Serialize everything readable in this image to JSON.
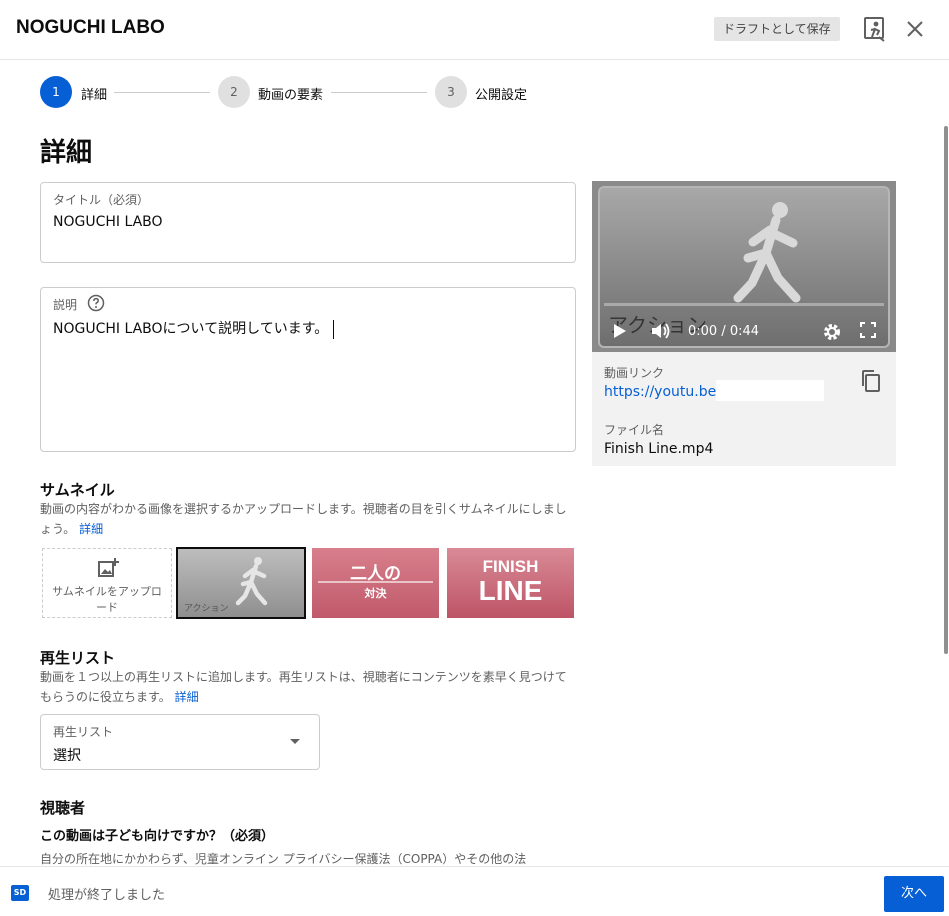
{
  "header": {
    "title": "NOGUCHI LABO",
    "save_draft_label": "ドラフトとして保存",
    "feedback_icon": "feedback-icon",
    "close_icon": "close-icon"
  },
  "stepper": {
    "steps": [
      {
        "number": "1",
        "label": "詳細",
        "active": true
      },
      {
        "number": "2",
        "label": "動画の要素",
        "active": false
      },
      {
        "number": "3",
        "label": "公開設定",
        "active": false
      }
    ]
  },
  "page": {
    "title": "詳細"
  },
  "title_field": {
    "label": "タイトル（必須）",
    "value": "NOGUCHI LABO"
  },
  "description_field": {
    "label": "説明",
    "value": "NOGUCHI LABOについて説明しています。",
    "help_icon": "help-icon"
  },
  "video_card": {
    "overlay_text": "アクション",
    "time": "0:00 / 0:44",
    "link_label": "動画リンク",
    "link_value": "https://youtu.be/",
    "filename_label": "ファイル名",
    "filename_value": "Finish Line.mp4"
  },
  "thumbnail": {
    "title": "サムネイル",
    "description": "動画の内容がわかる画像を選択するかアップロードします。視聴者の目を引くサムネイルにしましょう。",
    "details_link": "詳細",
    "upload_label": "サムネイルをアップロード",
    "options": [
      {
        "text": "アクション"
      },
      {
        "line1": "二人の",
        "line2": "対決"
      },
      {
        "line1": "FINISH",
        "line2": "LINE"
      }
    ]
  },
  "playlist": {
    "title": "再生リスト",
    "description": "動画を１つ以上の再生リストに追加します。再生リストは、視聴者にコンテンツを素早く見つけてもらうのに役立ちます。",
    "details_link": "詳細",
    "select_label": "再生リスト",
    "select_value": "選択"
  },
  "audience": {
    "title": "視聴者",
    "question": "この動画は子ども向けですか？（必須）",
    "description": "自分の所在地にかかわらず、児童オンライン プライバシー保護法（COPPA）やその他の法"
  },
  "footer": {
    "quality_badge": "SD",
    "status": "処理が終了しました",
    "next_label": "次へ"
  },
  "colors": {
    "accent": "#065fd4",
    "border": "#cccccc",
    "muted_text": "#606060"
  }
}
